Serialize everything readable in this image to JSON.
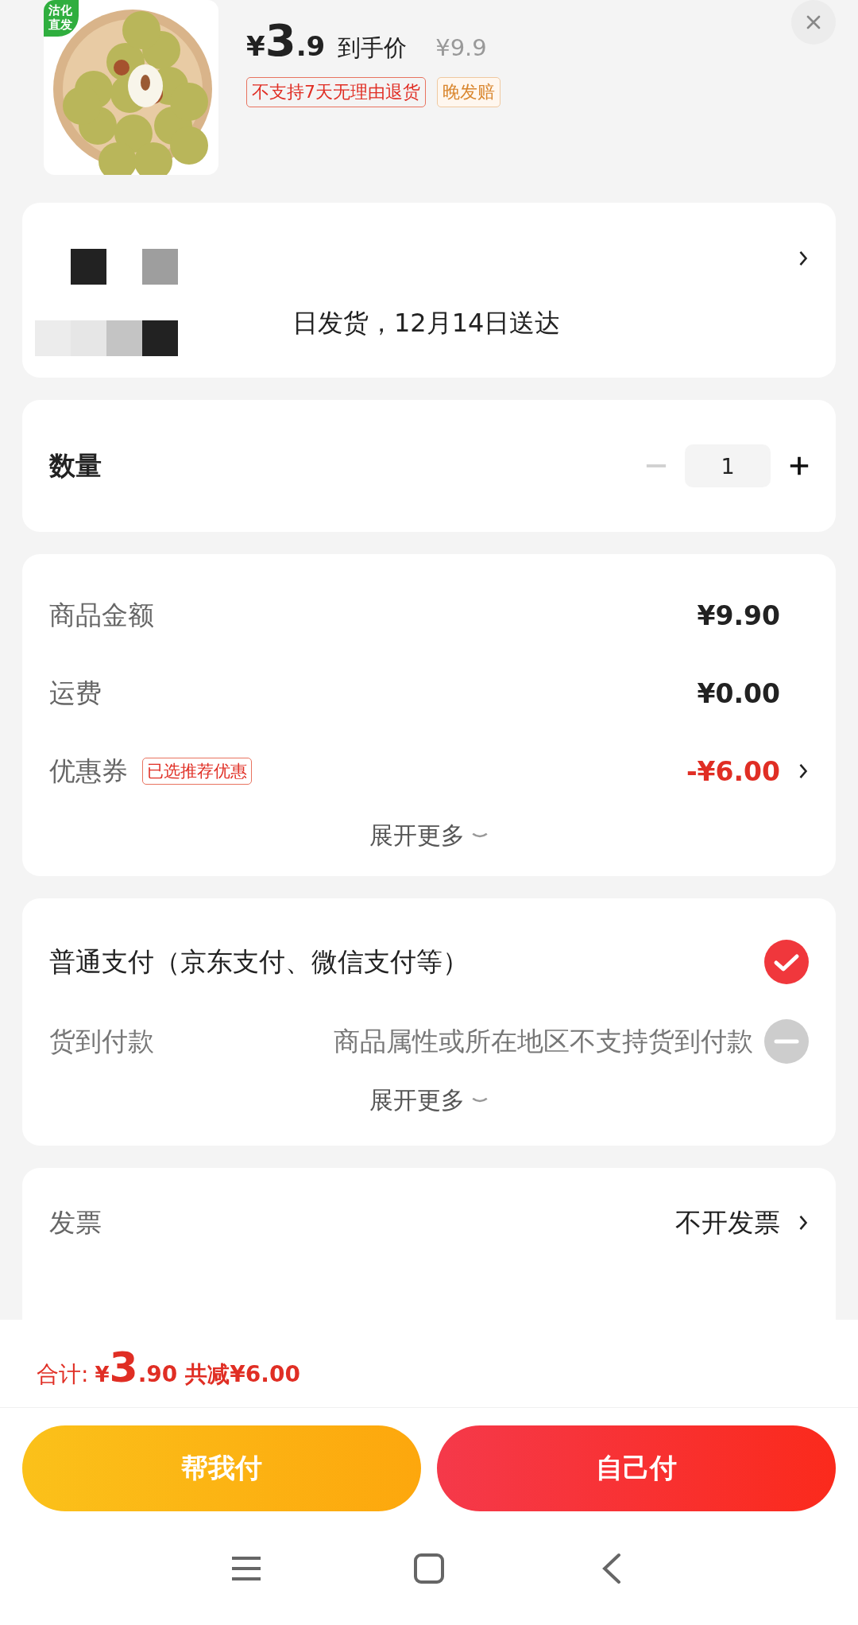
{
  "product": {
    "badge": "沽化直发",
    "currency": "¥",
    "integer": "3",
    "decimal": ".9",
    "price_label": "到手价",
    "original_price": "¥9.9",
    "tags": [
      {
        "text": "不支持7天无理由退货",
        "kind": "warning"
      },
      {
        "text": "晚发赔",
        "kind": "service"
      }
    ]
  },
  "address": {
    "delivery": "日发货，12月14日送达"
  },
  "quantity": {
    "label": "数量",
    "value": "1",
    "decrease_disabled": true
  },
  "costs": {
    "rows": [
      {
        "label": "商品金额",
        "value": "¥9.90",
        "kind": "plain"
      },
      {
        "label": "运费",
        "value": "¥0.00",
        "kind": "plain"
      },
      {
        "label": "优惠券",
        "tag": "已选推荐优惠",
        "value": "-¥6.00",
        "kind": "discount"
      }
    ],
    "expand": "展开更多"
  },
  "payment": {
    "options": [
      {
        "label": "普通支付（京东支付、微信支付等）",
        "selected": true,
        "disabled": false
      },
      {
        "label": "货到付款",
        "note": "商品属性或所在地区不支持货到付款",
        "selected": false,
        "disabled": true
      }
    ],
    "expand": "展开更多"
  },
  "invoice": {
    "label": "发票",
    "value": "不开发票"
  },
  "total": {
    "label": "合计:",
    "currency": "¥",
    "integer": "3",
    "decimal": ".90",
    "saving": "共减¥6.00"
  },
  "buttons": [
    {
      "label": "帮我付",
      "kind": "secondary"
    },
    {
      "label": "自己付",
      "kind": "primary"
    }
  ]
}
